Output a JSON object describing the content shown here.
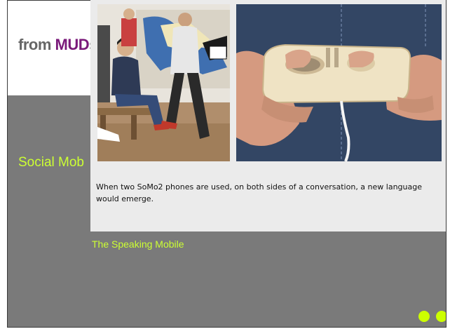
{
  "slide": {
    "brand": {
      "part1": "from ",
      "part2": "MUD",
      "part3": "s"
    },
    "title": "Social Mob",
    "subtitle": "The Speaking Mobile",
    "nav": {
      "prev_icon": "green-dot-icon",
      "next_icon": "green-dot-icon"
    }
  },
  "popup": {
    "images": [
      {
        "name": "gallery-photo",
        "icon": "photo"
      },
      {
        "name": "somo2-device-photo",
        "icon": "photo"
      }
    ],
    "caption": "When two SoMo2 phones are used, on both sides of a conversation, a new language would emerge."
  },
  "colors": {
    "accent_green": "#ccff33",
    "brand_purple": "#7a1a7a",
    "slide_gray": "#7a7a7a",
    "popup_bg": "#ebebeb"
  }
}
